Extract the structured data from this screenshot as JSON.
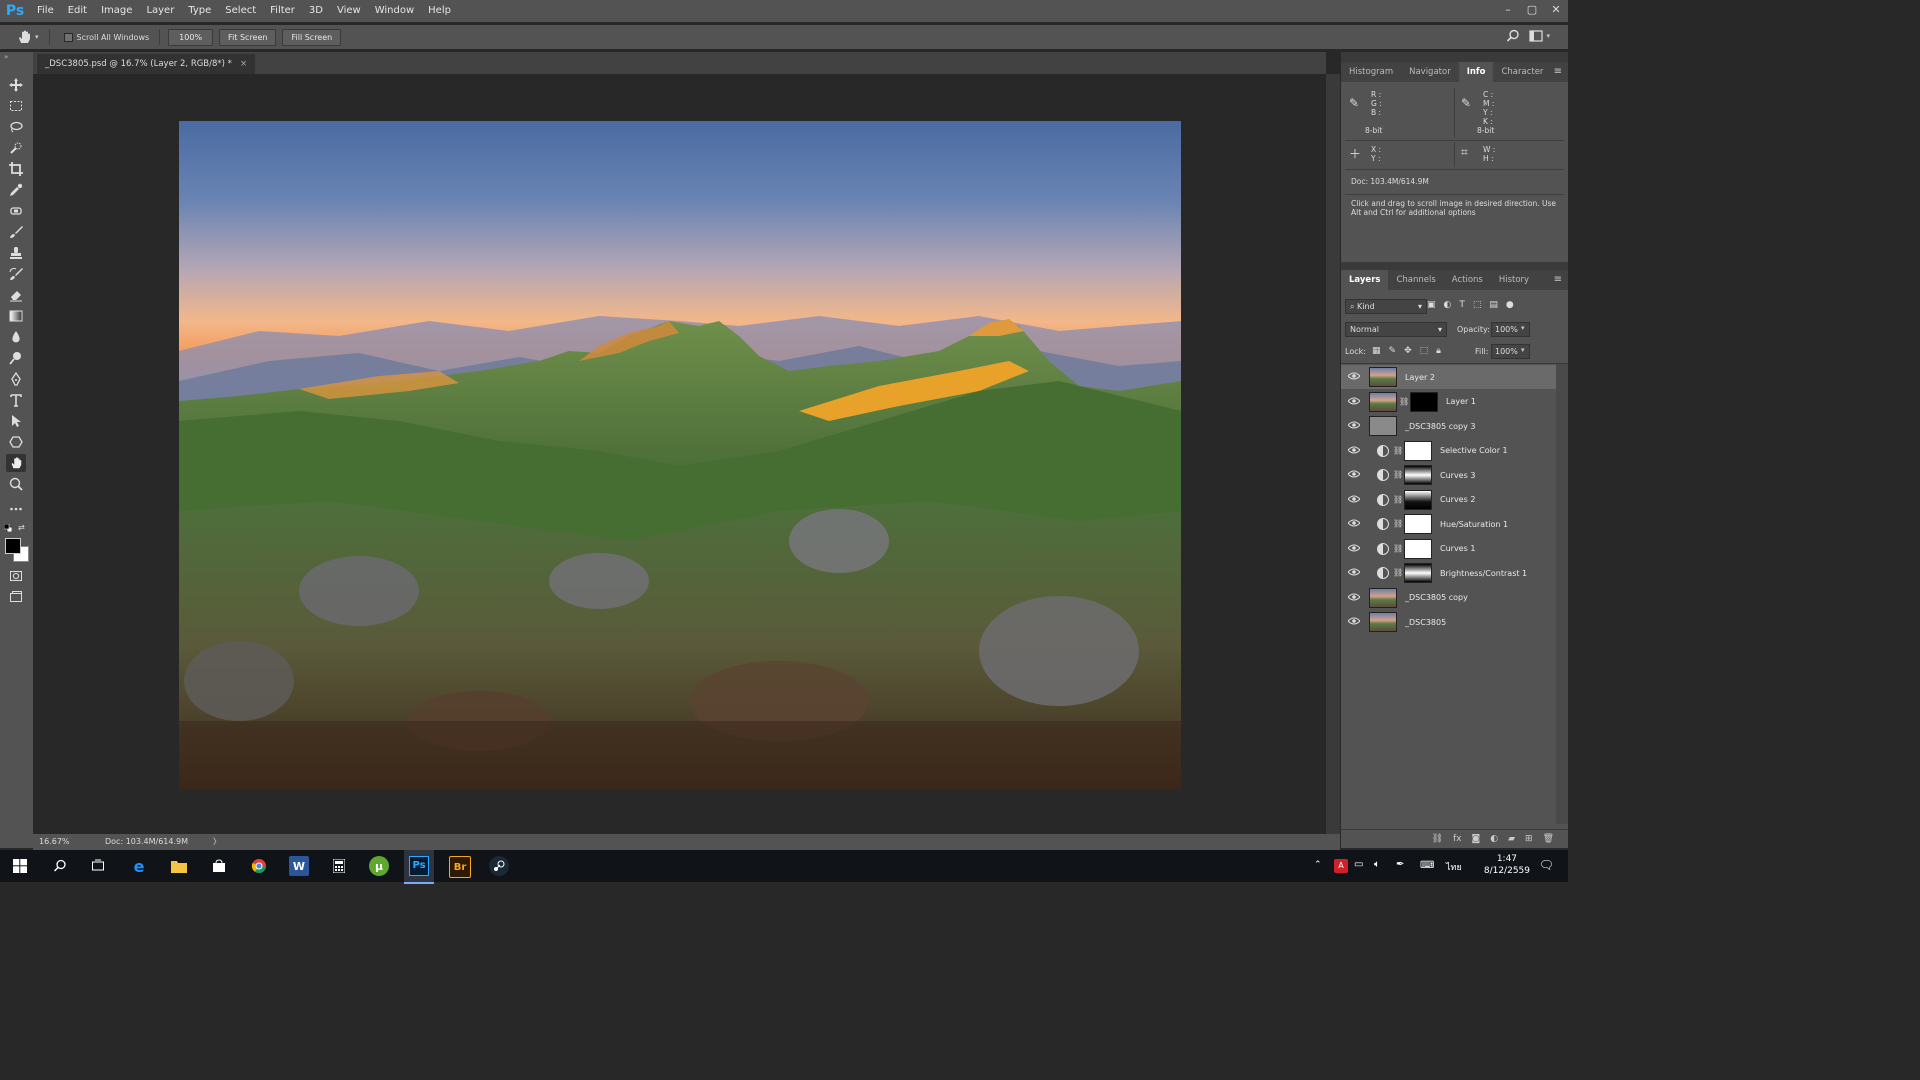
{
  "app": {
    "logo": "Ps"
  },
  "menu": [
    "File",
    "Edit",
    "Image",
    "Layer",
    "Type",
    "Select",
    "Filter",
    "3D",
    "View",
    "Window",
    "Help"
  ],
  "window_controls": [
    "–",
    "▢",
    "✕"
  ],
  "options": {
    "scroll_all_windows": "Scroll All Windows",
    "zoom_btn": "100%",
    "fit_screen": "Fit Screen",
    "fill_screen": "Fill Screen"
  },
  "document": {
    "tab_title": "_DSC3805.psd @ 16.7% (Layer 2, RGB/8*) *",
    "close": "×"
  },
  "status": {
    "zoom": "16.67%",
    "doc": "Doc: 103.4M/614.9M",
    "arrow": "〉"
  },
  "info_tabs": [
    "Histogram",
    "Navigator",
    "Info",
    "Character"
  ],
  "info": {
    "rgb_labels": "R :\nG :\nB :",
    "cmyk_labels": "C :\nM :\nY :\nK :",
    "bit_left": "8-bit",
    "bit_right": "8-bit",
    "xy_labels": "X :\nY :",
    "wh_labels": "W :\nH :",
    "doc": "Doc: 103.4M/614.9M",
    "hint": "Click and drag to scroll image in desired direction.  Use Alt and Ctrl for additional options"
  },
  "layers_tabs": [
    "Layers",
    "Channels",
    "Actions",
    "History"
  ],
  "layers_panel": {
    "kind": "Kind",
    "blend_mode": "Normal",
    "opacity_label": "Opacity:",
    "opacity_value": "100%",
    "lock_label": "Lock:",
    "fill_label": "Fill:",
    "fill_value": "100%"
  },
  "layers": [
    {
      "name": "Layer 2",
      "thumb": "pic",
      "selected": true
    },
    {
      "name": "Layer 1",
      "thumb": "pic",
      "mask": "black",
      "chain": true
    },
    {
      "name": "_DSC3805 copy 3",
      "thumb": "gray"
    },
    {
      "name": "Selective Color 1",
      "adj": true,
      "mask": "white",
      "chain": true
    },
    {
      "name": "Curves 3",
      "adj": true,
      "mask": "grad",
      "chain": true
    },
    {
      "name": "Curves 2",
      "adj": true,
      "mask": "grad2",
      "chain": true
    },
    {
      "name": "Hue/Saturation 1",
      "adj": true,
      "mask": "white",
      "chain": true
    },
    {
      "name": "Curves 1",
      "adj": true,
      "mask": "white",
      "chain": true
    },
    {
      "name": "Brightness/Contrast 1",
      "adj": true,
      "mask": "grad",
      "chain": true
    },
    {
      "name": "_DSC3805 copy",
      "thumb": "pic"
    },
    {
      "name": "_DSC3805",
      "thumb": "pic"
    }
  ],
  "clock": {
    "time": "1:47",
    "date": "8/12/2559"
  },
  "taskbar_lang": "ไทย"
}
